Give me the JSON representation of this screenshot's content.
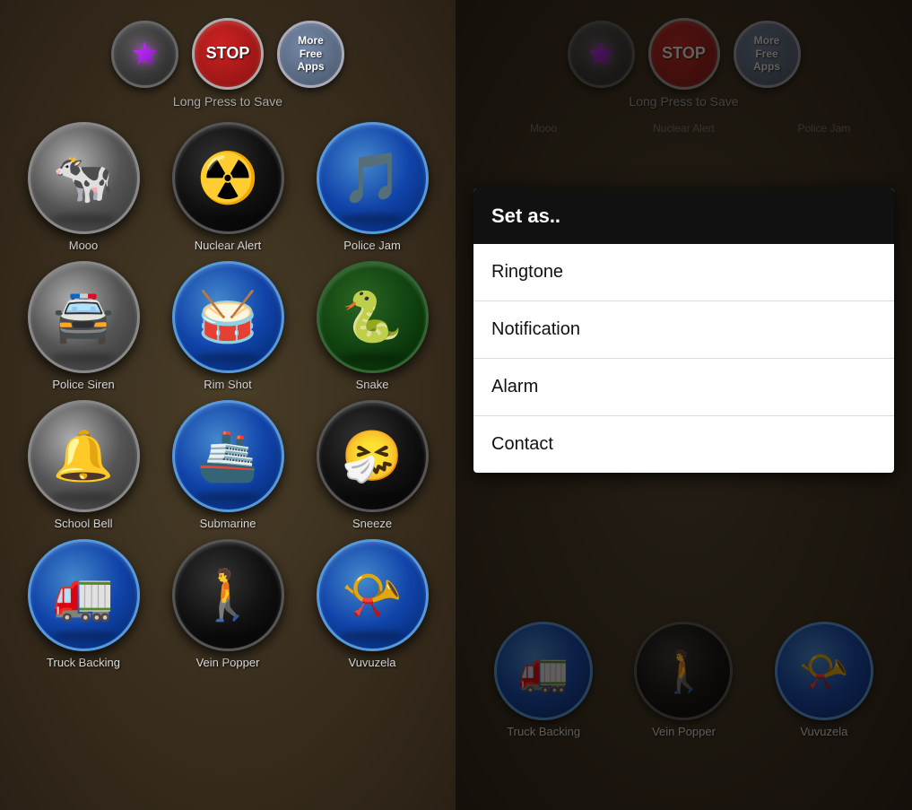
{
  "toolbar": {
    "star_icon": "★",
    "stop_label": "STOP",
    "more_label": "More\nFree\nApps",
    "long_press_label": "Long Press to Save"
  },
  "sounds": [
    {
      "id": "mooo",
      "label": "Mooo",
      "icon": "🐄",
      "style": "gray"
    },
    {
      "id": "nuclear-alert",
      "label": "Nuclear Alert",
      "icon": "☢️",
      "style": "dark"
    },
    {
      "id": "police-jam",
      "label": "Police Jam",
      "icon": "🎵",
      "style": "blue"
    },
    {
      "id": "police-siren",
      "label": "Police Siren",
      "icon": "🚔",
      "style": "gray"
    },
    {
      "id": "rim-shot",
      "label": "Rim Shot",
      "icon": "🥁",
      "style": "blue"
    },
    {
      "id": "snake",
      "label": "Snake",
      "icon": "🐍",
      "style": "dark"
    },
    {
      "id": "school-bell",
      "label": "School Bell",
      "icon": "🔔",
      "style": "gray"
    },
    {
      "id": "submarine",
      "label": "Submarine",
      "icon": "🚢",
      "style": "blue"
    },
    {
      "id": "sneeze",
      "label": "Sneeze",
      "icon": "🤧",
      "style": "dark"
    },
    {
      "id": "truck-backing",
      "label": "Truck Backing",
      "icon": "🚛",
      "style": "blue"
    },
    {
      "id": "vein-popper",
      "label": "Vein Popper",
      "icon": "🚶",
      "style": "dark"
    },
    {
      "id": "vuvuzela",
      "label": "Vuvuzela",
      "icon": "📯",
      "style": "blue"
    }
  ],
  "popup": {
    "header": "Set as..",
    "items": [
      {
        "id": "ringtone",
        "label": "Ringtone"
      },
      {
        "id": "notification",
        "label": "Notification"
      },
      {
        "id": "alarm",
        "label": "Alarm"
      },
      {
        "id": "contact",
        "label": "Contact"
      }
    ]
  },
  "right_panel": {
    "dimmed_labels": [
      "Mooo",
      "Nuclear Alert",
      "Police Jam"
    ],
    "bottom_labels": [
      "Truck Backing",
      "Vein Popper",
      "Vuvuzela"
    ]
  }
}
